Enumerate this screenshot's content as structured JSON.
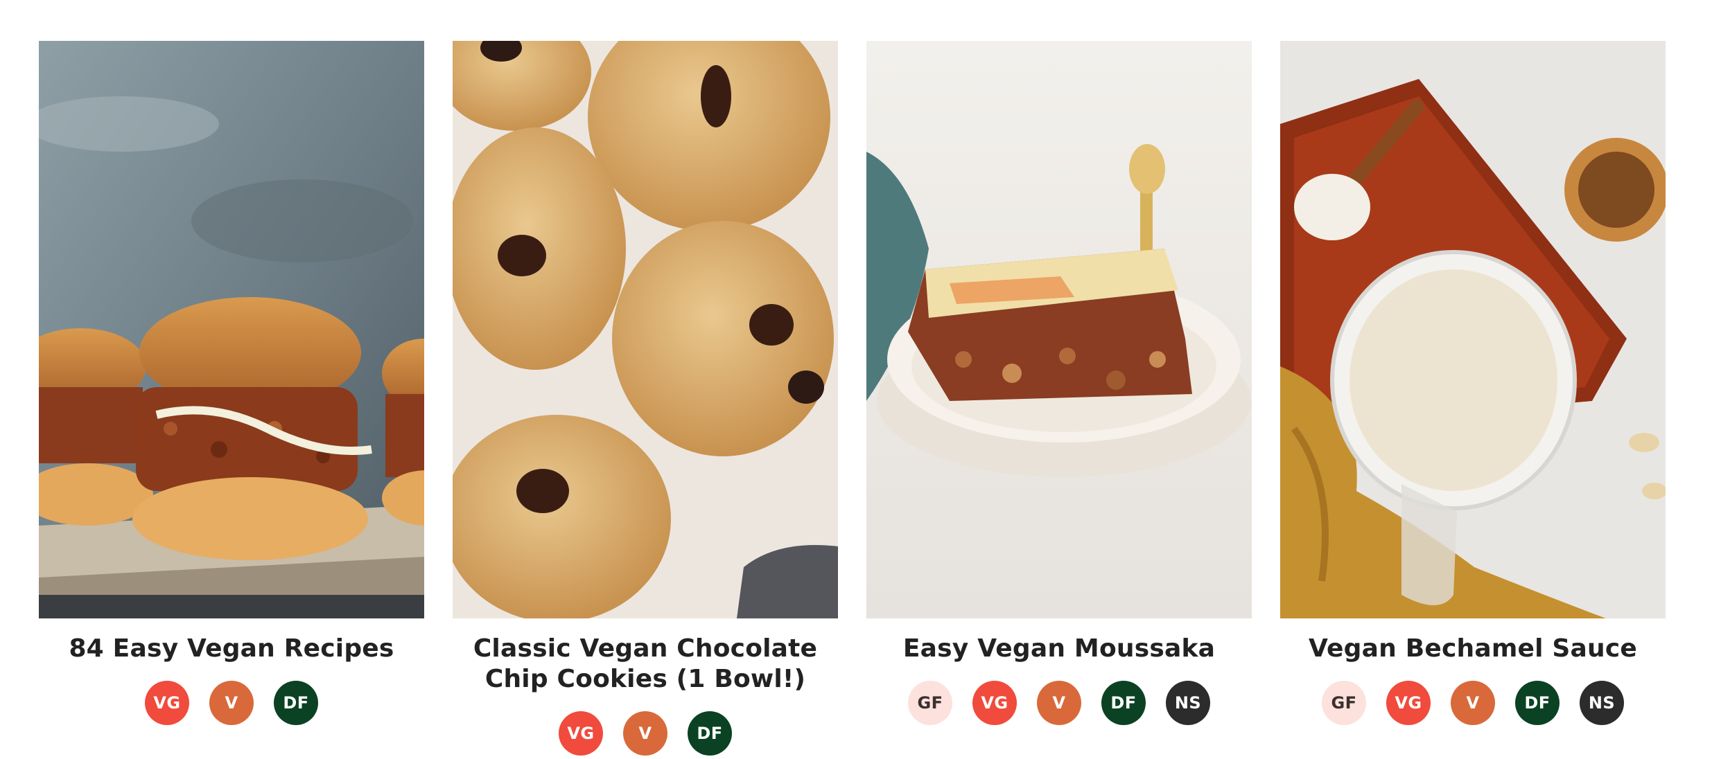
{
  "recipes": [
    {
      "title": "84 Easy Vegan Recipes",
      "image_alt": "sloppy-joe-sandwiches-photo",
      "badges": [
        {
          "code": "vg",
          "label": "VG"
        },
        {
          "code": "v",
          "label": "V"
        },
        {
          "code": "df",
          "label": "DF"
        }
      ]
    },
    {
      "title": "Classic Vegan Chocolate Chip Cookies (1 Bowl!)",
      "image_alt": "chocolate-chip-cookies-photo",
      "badges": [
        {
          "code": "vg",
          "label": "VG"
        },
        {
          "code": "v",
          "label": "V"
        },
        {
          "code": "df",
          "label": "DF"
        }
      ]
    },
    {
      "title": "Easy Vegan Moussaka",
      "image_alt": "moussaka-slice-photo",
      "badges": [
        {
          "code": "gf",
          "label": "GF"
        },
        {
          "code": "vg",
          "label": "VG"
        },
        {
          "code": "v",
          "label": "V"
        },
        {
          "code": "df",
          "label": "DF"
        },
        {
          "code": "ns",
          "label": "NS"
        }
      ]
    },
    {
      "title": "Vegan Bechamel Sauce",
      "image_alt": "bechamel-sauce-photo",
      "badges": [
        {
          "code": "gf",
          "label": "GF"
        },
        {
          "code": "vg",
          "label": "VG"
        },
        {
          "code": "v",
          "label": "V"
        },
        {
          "code": "df",
          "label": "DF"
        },
        {
          "code": "ns",
          "label": "NS"
        }
      ]
    }
  ],
  "colors": {
    "gf": "#fde1dd",
    "vg": "#f04b3c",
    "v": "#d9693a",
    "df": "#0b4223",
    "ns": "#2c2c2c"
  }
}
